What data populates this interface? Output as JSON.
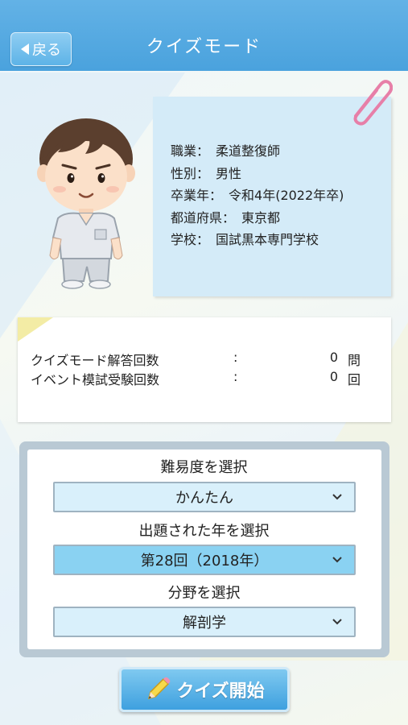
{
  "header": {
    "title": "クイズモード",
    "back_label": "戻る"
  },
  "profile": {
    "items": [
      {
        "label": "職業：",
        "value": "柔道整復師"
      },
      {
        "label": "性別：",
        "value": "男性"
      },
      {
        "label": "卒業年：",
        "value": "令和4年(2022年卒)"
      },
      {
        "label": "都道府県：",
        "value": "東京都"
      },
      {
        "label": "学校：",
        "value": "国試黒本専門学校"
      }
    ]
  },
  "stats": {
    "rows": [
      {
        "label": "クイズモード解答回数",
        "colon": ":",
        "value": "0",
        "unit": "問"
      },
      {
        "label": "イベント模試受験回数",
        "colon": ":",
        "value": "0",
        "unit": "回"
      }
    ]
  },
  "selection": {
    "difficulty_label": "難易度を選択",
    "difficulty_value": "かんたん",
    "year_label": "出題された年を選択",
    "year_value": "第28回（2018年）",
    "field_label": "分野を選択",
    "field_value": "解剖学"
  },
  "start_button": {
    "label": "クイズ開始"
  },
  "colors": {
    "header": "#4aa2dd",
    "card_blue": "#d4ebf8",
    "dropdown_light": "#d9f0fb",
    "dropdown_active": "#8ad2f2",
    "paperclip": "#e77fa8"
  },
  "icons": {
    "back": "triangle-left-icon",
    "paperclip": "paperclip-icon",
    "chevron": "chevron-down-icon",
    "pencil": "pencil-icon"
  }
}
